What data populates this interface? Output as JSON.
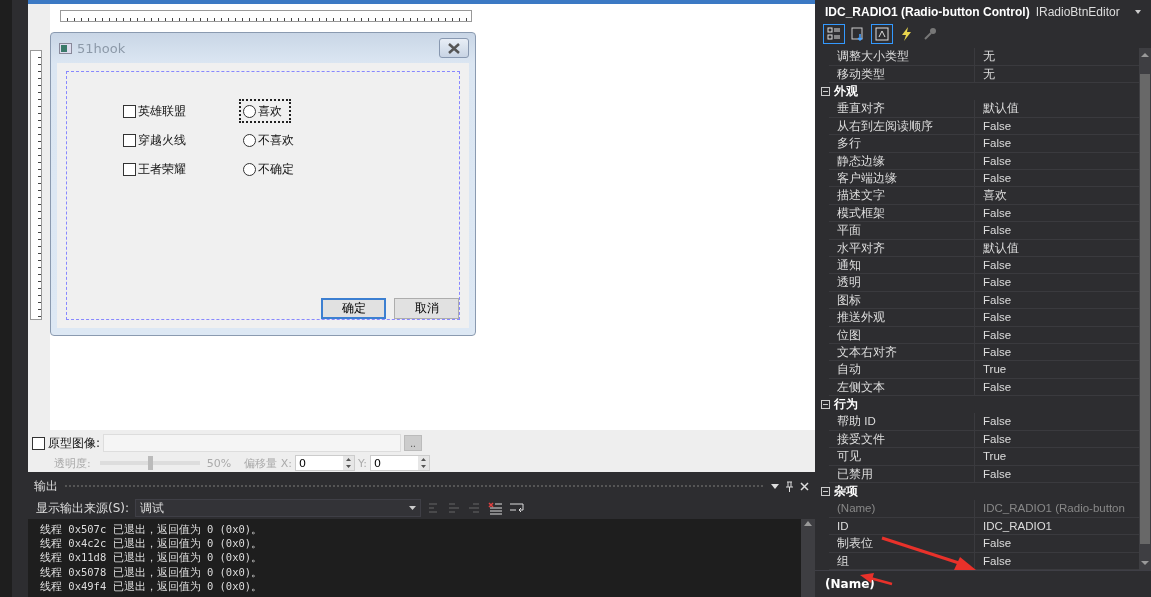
{
  "designer": {
    "dialog": {
      "title": "51hook",
      "checkboxes": [
        {
          "label": "英雄联盟",
          "checked": false
        },
        {
          "label": "穿越火线",
          "checked": false
        },
        {
          "label": "王者荣耀",
          "checked": false
        }
      ],
      "radios": [
        {
          "label": "喜欢",
          "selected": false,
          "focused": true
        },
        {
          "label": "不喜欢",
          "selected": false,
          "focused": false
        },
        {
          "label": "不确定",
          "selected": false,
          "focused": false
        }
      ],
      "buttons": [
        {
          "label": "确定",
          "default": true
        },
        {
          "label": "取消",
          "default": false
        }
      ]
    },
    "prototype": {
      "label": "原型图像:",
      "checked": false,
      "browse": "..",
      "opacity_label": "透明度:",
      "level": 0.5,
      "opacity_value": "50%",
      "offset_x_label": "偏移量 X:",
      "x_value": "0",
      "y_label": "Y:",
      "y_value": "0"
    }
  },
  "output": {
    "title": "输出",
    "source_label": "显示输出来源(S):",
    "source_value": "调试",
    "lines": [
      "线程 0x507c 已退出，返回值为 0 (0x0)。",
      "线程 0x4c2c 已退出，返回值为 0 (0x0)。",
      "线程 0x11d8 已退出，返回值为 0 (0x0)。",
      "线程 0x5078 已退出，返回值为 0 (0x0)。",
      "线程 0x49f4 已退出，返回值为 0 (0x0)。"
    ]
  },
  "properties": {
    "title": "IDC_RADIO1 (Radio-button Control)",
    "editor": "IRadioBtnEditor",
    "toolbar": [
      {
        "kind": "categorized",
        "selected": true
      },
      {
        "kind": "pages",
        "selected": false
      },
      {
        "kind": "properties",
        "selected": true
      },
      {
        "kind": "events",
        "selected": false
      },
      {
        "kind": "overrides",
        "selected": false
      }
    ],
    "groups": [
      {
        "rows": [
          {
            "name": "调整大小类型",
            "value": "无",
            "disabled": false
          },
          {
            "name": "移动类型",
            "value": "无",
            "disabled": false
          }
        ]
      },
      {
        "title": "外观",
        "expanded": true,
        "rows": [
          {
            "name": "垂直对齐",
            "value": "默认值",
            "disabled": false
          },
          {
            "name": "从右到左阅读顺序",
            "value": "False",
            "disabled": false
          },
          {
            "name": "多行",
            "value": "False",
            "disabled": false
          },
          {
            "name": "静态边缘",
            "value": "False",
            "disabled": false
          },
          {
            "name": "客户端边缘",
            "value": "False",
            "disabled": false
          },
          {
            "name": "描述文字",
            "value": "喜欢",
            "disabled": false
          },
          {
            "name": "模式框架",
            "value": "False",
            "disabled": false
          },
          {
            "name": "平面",
            "value": "False",
            "disabled": false
          },
          {
            "name": "水平对齐",
            "value": "默认值",
            "disabled": false
          },
          {
            "name": "通知",
            "value": "False",
            "disabled": false
          },
          {
            "name": "透明",
            "value": "False",
            "disabled": false
          },
          {
            "name": "图标",
            "value": "False",
            "disabled": false
          },
          {
            "name": "推送外观",
            "value": "False",
            "disabled": false
          },
          {
            "name": "位图",
            "value": "False",
            "disabled": false
          },
          {
            "name": "文本右对齐",
            "value": "False",
            "disabled": false
          },
          {
            "name": "自动",
            "value": "True",
            "disabled": false
          },
          {
            "name": "左侧文本",
            "value": "False",
            "disabled": false
          }
        ]
      },
      {
        "title": "行为",
        "expanded": true,
        "rows": [
          {
            "name": "帮助 ID",
            "value": "False",
            "disabled": false
          },
          {
            "name": "接受文件",
            "value": "False",
            "disabled": false
          },
          {
            "name": "可见",
            "value": "True",
            "disabled": false
          },
          {
            "name": "已禁用",
            "value": "False",
            "disabled": false
          }
        ]
      },
      {
        "title": "杂项",
        "expanded": true,
        "rows": [
          {
            "name": "(Name)",
            "value": "IDC_RADIO1 (Radio-button",
            "disabled": true
          },
          {
            "name": "ID",
            "value": "IDC_RADIO1",
            "disabled": false
          },
          {
            "name": "制表位",
            "value": "False",
            "disabled": false
          },
          {
            "name": "组",
            "value": "False",
            "disabled": false
          }
        ]
      }
    ],
    "description_title": "(Name)"
  }
}
